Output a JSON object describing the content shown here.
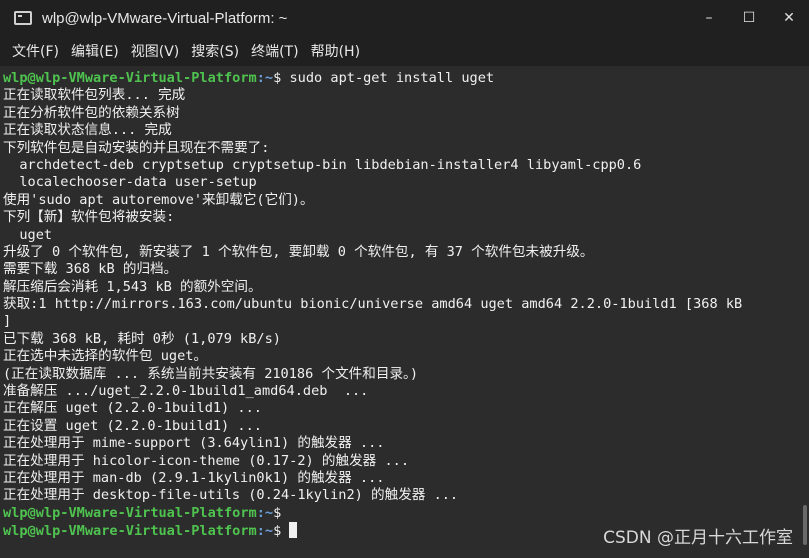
{
  "window": {
    "title": "wlp@wlp-VMware-Virtual-Platform: ~",
    "minimize": "–",
    "maximize": "☐",
    "close": "✕"
  },
  "menu": [
    "文件(F)",
    "编辑(E)",
    "视图(V)",
    "搜索(S)",
    "终端(T)",
    "帮助(H)"
  ],
  "prompt": {
    "user_host": "wlp@wlp-VMware-Virtual-Platform",
    "path": ":~",
    "symbol": "$ "
  },
  "lines": [
    {
      "prompt": true,
      "cmd": "sudo apt-get install uget"
    },
    {
      "text": "正在读取软件包列表... 完成"
    },
    {
      "text": "正在分析软件包的依赖关系树"
    },
    {
      "text": "正在读取状态信息... 完成"
    },
    {
      "text": "下列软件包是自动安装的并且现在不需要了:"
    },
    {
      "text": "  archdetect-deb cryptsetup cryptsetup-bin libdebian-installer4 libyaml-cpp0.6"
    },
    {
      "text": "  localechooser-data user-setup"
    },
    {
      "text": "使用'sudo apt autoremove'来卸载它(它们)。"
    },
    {
      "text": "下列【新】软件包将被安装:"
    },
    {
      "text": "  uget"
    },
    {
      "text": "升级了 0 个软件包, 新安装了 1 个软件包, 要卸载 0 个软件包, 有 37 个软件包未被升级。"
    },
    {
      "text": "需要下载 368 kB 的归档。"
    },
    {
      "text": "解压缩后会消耗 1,543 kB 的额外空间。"
    },
    {
      "text": "获取:1 http://mirrors.163.com/ubuntu bionic/universe amd64 uget amd64 2.2.0-1build1 [368 kB"
    },
    {
      "text": "]"
    },
    {
      "text": "已下载 368 kB, 耗时 0秒 (1,079 kB/s)"
    },
    {
      "text": "正在选中未选择的软件包 uget。"
    },
    {
      "text": "(正在读取数据库 ... 系统当前共安装有 210186 个文件和目录。)"
    },
    {
      "text": "准备解压 .../uget_2.2.0-1build1_amd64.deb  ..."
    },
    {
      "text": "正在解压 uget (2.2.0-1build1) ..."
    },
    {
      "text": "正在设置 uget (2.2.0-1build1) ..."
    },
    {
      "text": "正在处理用于 mime-support (3.64ylin1) 的触发器 ..."
    },
    {
      "text": "正在处理用于 hicolor-icon-theme (0.17-2) 的触发器 ..."
    },
    {
      "text": "正在处理用于 man-db (2.9.1-1kylin0k1) 的触发器 ..."
    },
    {
      "text": "正在处理用于 desktop-file-utils (0.24-1kylin2) 的触发器 ..."
    },
    {
      "prompt": true,
      "cmd": ""
    },
    {
      "prompt": true,
      "cmd": "",
      "cursor": true
    }
  ],
  "watermark": "CSDN @正月十六工作室"
}
